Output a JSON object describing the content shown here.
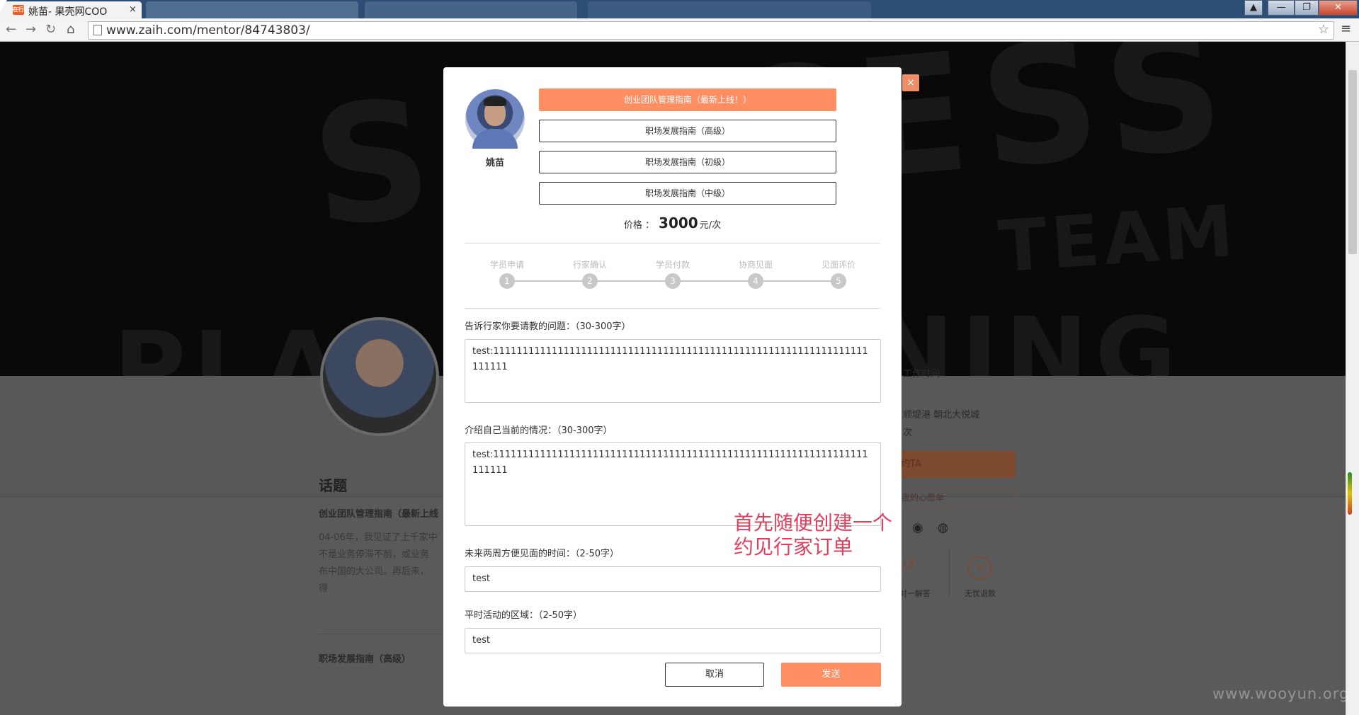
{
  "browser": {
    "tab_title": "姚苗- 果壳网COO",
    "tab_close": "×",
    "favicon_text": "在行",
    "url": "www.zaih.com/mentor/84743803/",
    "win_min": "—",
    "win_max": "❐",
    "win_close": "✕"
  },
  "background": {
    "hero_words": [
      "SUCCESS",
      "TEAM",
      "PLA",
      "NING"
    ],
    "topics_heading": "话题",
    "topic1": "创业团队管理指南（最新上线",
    "paragraph": [
      "04-06年，我见证了上千家中",
      "不是业务停滞不前，或业务",
      "布中国的大公司。再后来，",
      "得"
    ],
    "topic2": "职场发展指南（高级）",
    "right_text": [
      "工作时间",
      "顺堤港 朝北大悦城",
      "次"
    ],
    "orange_button": "约TA",
    "outline_button": "我的心愿单",
    "left_label": "对一解答",
    "refund_label": "无忧退款",
    "refund_symbol": "¥"
  },
  "modal": {
    "close": "×",
    "mentor_name": "姚苗",
    "topics": [
      {
        "label": "创业团队管理指南（最新上线！）",
        "active": true
      },
      {
        "label": "职场发展指南（高级）",
        "active": false
      },
      {
        "label": "职场发展指南（初级）",
        "active": false
      },
      {
        "label": "职场发展指南（中级）",
        "active": false
      }
    ],
    "price_label": "价格 ：",
    "price_value": "3000",
    "price_unit": "元/次",
    "steps": [
      {
        "label": "学员申请",
        "num": "1"
      },
      {
        "label": "行家确认",
        "num": "2"
      },
      {
        "label": "学员付款",
        "num": "3"
      },
      {
        "label": "协商见面",
        "num": "4"
      },
      {
        "label": "见面评价",
        "num": "5"
      }
    ],
    "question_label": "告诉行家你要请教的问题：（30-300字）",
    "question_value": "test:1111111111111111111111111111111111111111111111111111111111111111111111",
    "intro_label": "介绍自己当前的情况：（30-300字）",
    "intro_value": "test:1111111111111111111111111111111111111111111111111111111111111111111111",
    "time_label": "未来两周方便见面的时间：（2-50字）",
    "time_value": "test",
    "area_label": "平时活动的区域：（2-50字）",
    "area_value": "test",
    "cancel": "取消",
    "send": "发送"
  },
  "annotation": [
    "首先随便创建一个",
    "约见行家订单"
  ],
  "watermark": "www.wooyun.org",
  "colors": {
    "accent": "#ff8f62",
    "annotation": "#e0405e"
  }
}
